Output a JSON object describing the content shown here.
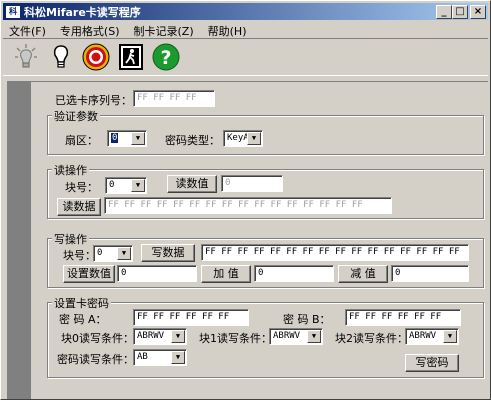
{
  "window": {
    "title": "科松Mifare卡读写程序",
    "app_icon": "科"
  },
  "title_buttons": {
    "minimize": "_",
    "maximize": "□",
    "close": "×"
  },
  "menu": [
    {
      "label": "文件(F)"
    },
    {
      "label": "专用格式(S)"
    },
    {
      "label": "制卡记录(Z)"
    },
    {
      "label": "帮助(H)"
    }
  ],
  "toolbar": [
    "light-bulb-off-icon",
    "light-bulb-icon",
    "target-icon",
    "exit-person-icon",
    "help-icon"
  ],
  "selected_card": {
    "label": "已选卡序列号：",
    "value": "FF FF FF FF"
  },
  "verify": {
    "title": "验证参数",
    "sector_label": "扇区：",
    "sector_value": "0",
    "keytype_label": "密码类型：",
    "keytype_value": "KeyA"
  },
  "read": {
    "title": "读操作",
    "block_label": "块号：",
    "block_value": "0",
    "read_value_btn": "读数值",
    "read_value_field": "0",
    "read_data_btn": "读数据",
    "read_data_field": "FF FF FF FF FF FF FF FF FF FF FF FF FF FF FF FF"
  },
  "write": {
    "title": "写操作",
    "block_label": "块号：",
    "block_value": "0",
    "write_data_btn": "写数据",
    "write_data_field": "FF FF FF FF FF FF FF FF FF FF FF FF FF FF FF FF",
    "set_value_btn": "设置数值",
    "set_value_field": "0",
    "add_btn": "加  值",
    "add_field": "0",
    "sub_btn": "减  值",
    "sub_field": "0"
  },
  "setpw": {
    "title": "设置卡密码",
    "pwA_label": "密  码  A：",
    "pwA_value": "FF FF FF FF FF FF",
    "pwB_label": "密  码  B：",
    "pwB_value": "FF FF FF FF FF FF",
    "b0_label": "块0读写条件：",
    "b0_value": "ABRWV",
    "b1_label": "块1读写条件：",
    "b1_value": "ABRWV",
    "b2_label": "块2读写条件：",
    "b2_value": "ABRWV",
    "pwcond_label": "密码读写条件：",
    "pwcond_value": "AB",
    "write_pw_btn": "写密码"
  }
}
